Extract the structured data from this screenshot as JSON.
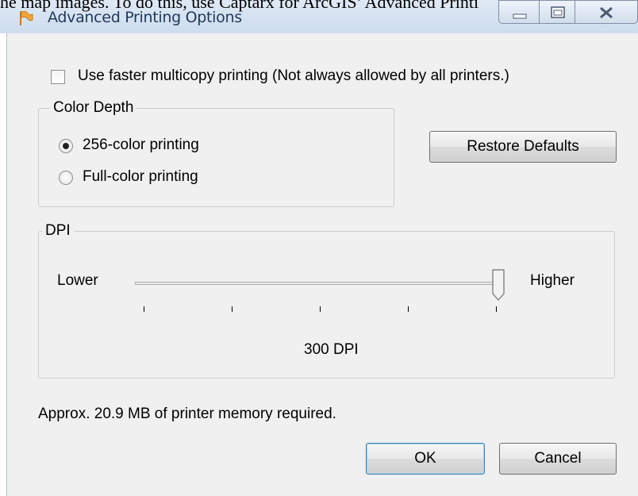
{
  "background_doc": {
    "text": "he map images. To do this, use Captarx for ArcGIS’ Advanced Printi"
  },
  "window": {
    "title": "Advanced Printing Options"
  },
  "options": {
    "multicopy_label": "Use faster multicopy printing  (Not always allowed by all printers.)",
    "multicopy_checked": false
  },
  "color_depth": {
    "legend": "Color Depth",
    "options": [
      {
        "label": "256-color printing",
        "selected": true
      },
      {
        "label": "Full-color printing",
        "selected": false
      }
    ]
  },
  "buttons": {
    "restore": "Restore Defaults",
    "ok": "OK",
    "cancel": "Cancel"
  },
  "dpi": {
    "legend": "DPI",
    "lower_label": "Lower",
    "higher_label": "Higher",
    "value_text": "300 DPI",
    "slider_position": 1.0
  },
  "memory_text": "Approx. 20.9 MB of printer memory required.",
  "colors": {
    "titlebar": "#cddcee",
    "dialog_bg": "#f0f0f0",
    "default_button_border": "#3c7fb1"
  }
}
